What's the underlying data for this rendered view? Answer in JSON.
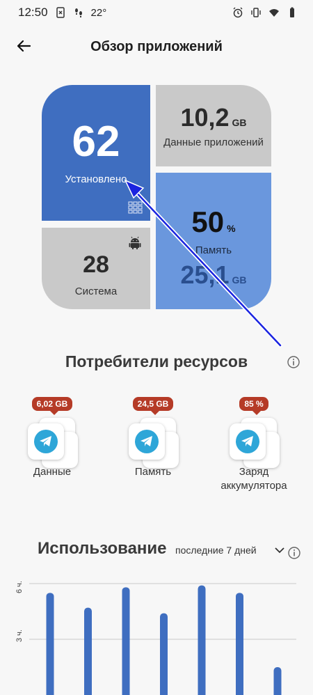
{
  "status_bar": {
    "time": "12:50",
    "temperature": "22°"
  },
  "header": {
    "title": "Обзор приложений"
  },
  "tiles": {
    "installed": {
      "value": "62",
      "label": "Установлено"
    },
    "app_data": {
      "value": "10,2",
      "unit": "GB",
      "label": "Данные приложений"
    },
    "system": {
      "value": "28",
      "label": "Система"
    },
    "memory": {
      "percent": "50",
      "percent_unit": "%",
      "label": "Память",
      "size": "25,1",
      "size_unit": "GB"
    }
  },
  "consumers": {
    "title": "Потребители ресурсов",
    "items": [
      {
        "badge": "6,02 GB",
        "label": "Данные"
      },
      {
        "badge": "24,5 GB",
        "label": "Память"
      },
      {
        "badge": "85 %",
        "label": "Заряд аккумулятора"
      }
    ]
  },
  "usage": {
    "title": "Использование",
    "period": "последние 7 дней"
  },
  "chart_data": {
    "type": "bar",
    "y_ticks": [
      "6 ч.",
      "3 ч."
    ],
    "ylim": [
      0,
      6
    ],
    "values": [
      5.5,
      4.7,
      5.8,
      4.4,
      5.9,
      5.5,
      1.5
    ]
  },
  "colors": {
    "installed_tile": "#3f6ec0",
    "memory_tile": "#6a97dd",
    "gray_tile": "#c9c9c9",
    "badge": "#b53b27",
    "bar": "#3f6ec0"
  }
}
